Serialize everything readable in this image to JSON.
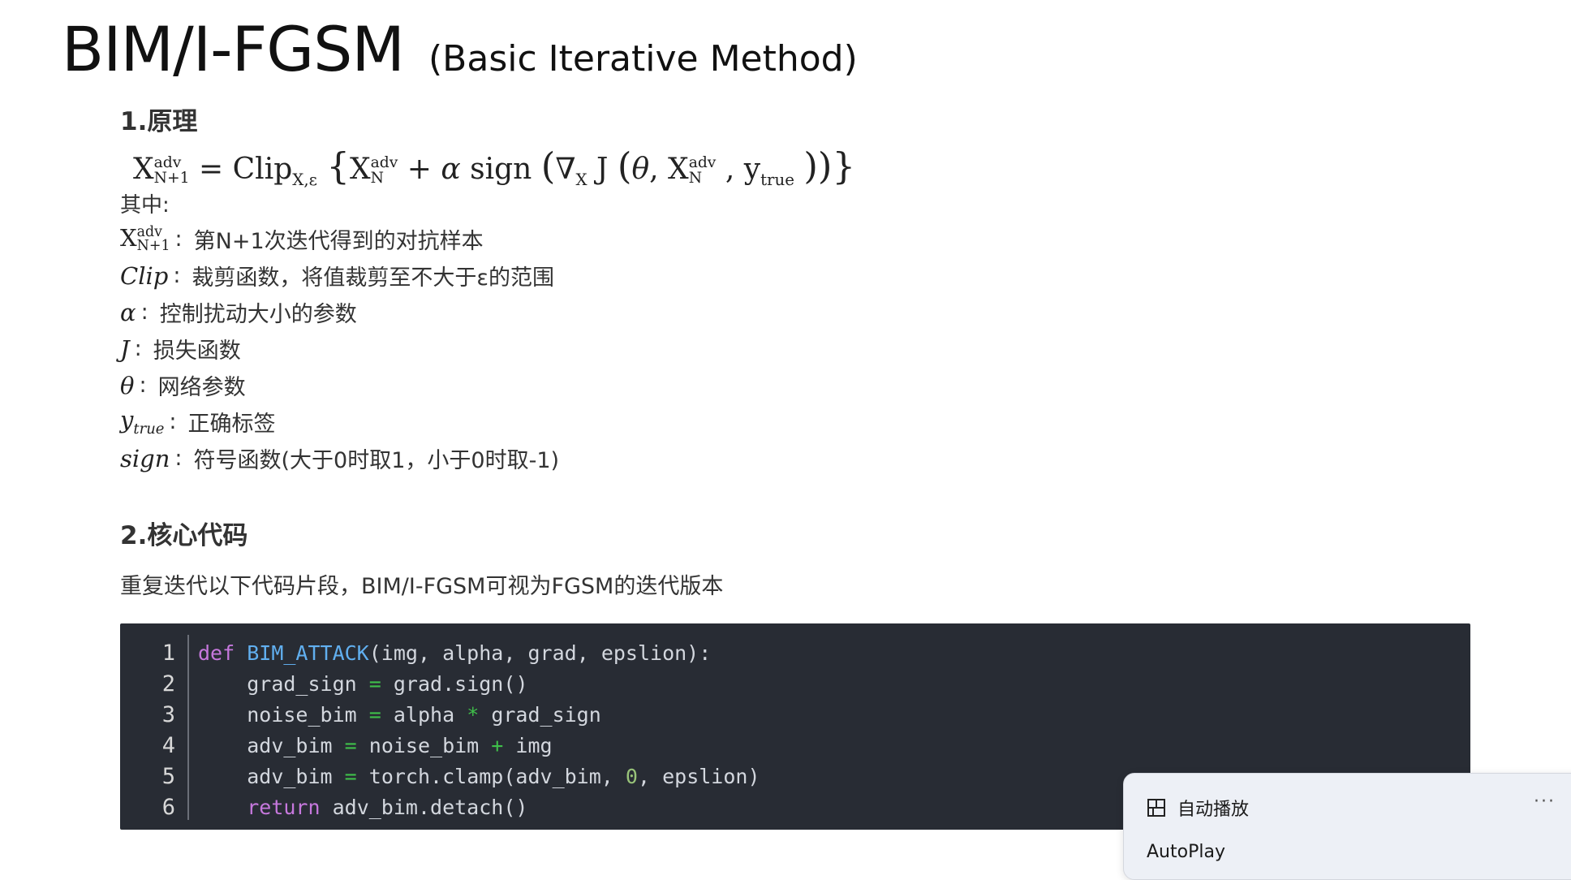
{
  "title": {
    "main": "BIM/I-FGSM",
    "sub": "(Basic Iterative Method)"
  },
  "section1": {
    "heading": "1.原理",
    "where": "其中:",
    "definitions": [
      {
        "symbol": "X",
        "sup": "adv",
        "sub": "N+1",
        "text": "第N+1次迭代得到的对抗样本"
      },
      {
        "symbol": "Clip",
        "text": "裁剪函数，将值裁剪至不大于ε的范围"
      },
      {
        "symbol": "α",
        "text": "控制扰动大小的参数"
      },
      {
        "symbol": "J",
        "text": "损失函数"
      },
      {
        "symbol": "θ",
        "text": "网络参数"
      },
      {
        "symbol": "y",
        "sub": "true",
        "text": "正确标签"
      },
      {
        "symbol": "sign",
        "text": "符号函数(大于0时取1，小于0时取-1)"
      }
    ]
  },
  "section2": {
    "heading": "2.核心代码",
    "intro": "重复迭代以下代码片段，BIM/I-FGSM可视为FGSM的迭代版本"
  },
  "code": {
    "line_numbers": [
      "1",
      "2",
      "3",
      "4",
      "5",
      "6"
    ],
    "lines": [
      "def BIM_ATTACK(img, alpha, grad, epslion):",
      "    grad_sign = grad.sign()",
      "    noise_bim = alpha * grad_sign",
      "    adv_bim = noise_bim + img",
      "    adv_bim = torch.clamp(adv_bim, 0, epslion)",
      "    return adv_bim.detach()"
    ],
    "colors": {
      "background": "#282c34",
      "keyword": "#c678dd",
      "function": "#61afef",
      "operator": "#3fbf4a",
      "number": "#98c379",
      "text": "#d3d7de"
    }
  },
  "toast": {
    "title": "自动播放",
    "more": "···",
    "text": "AutoPlay"
  }
}
